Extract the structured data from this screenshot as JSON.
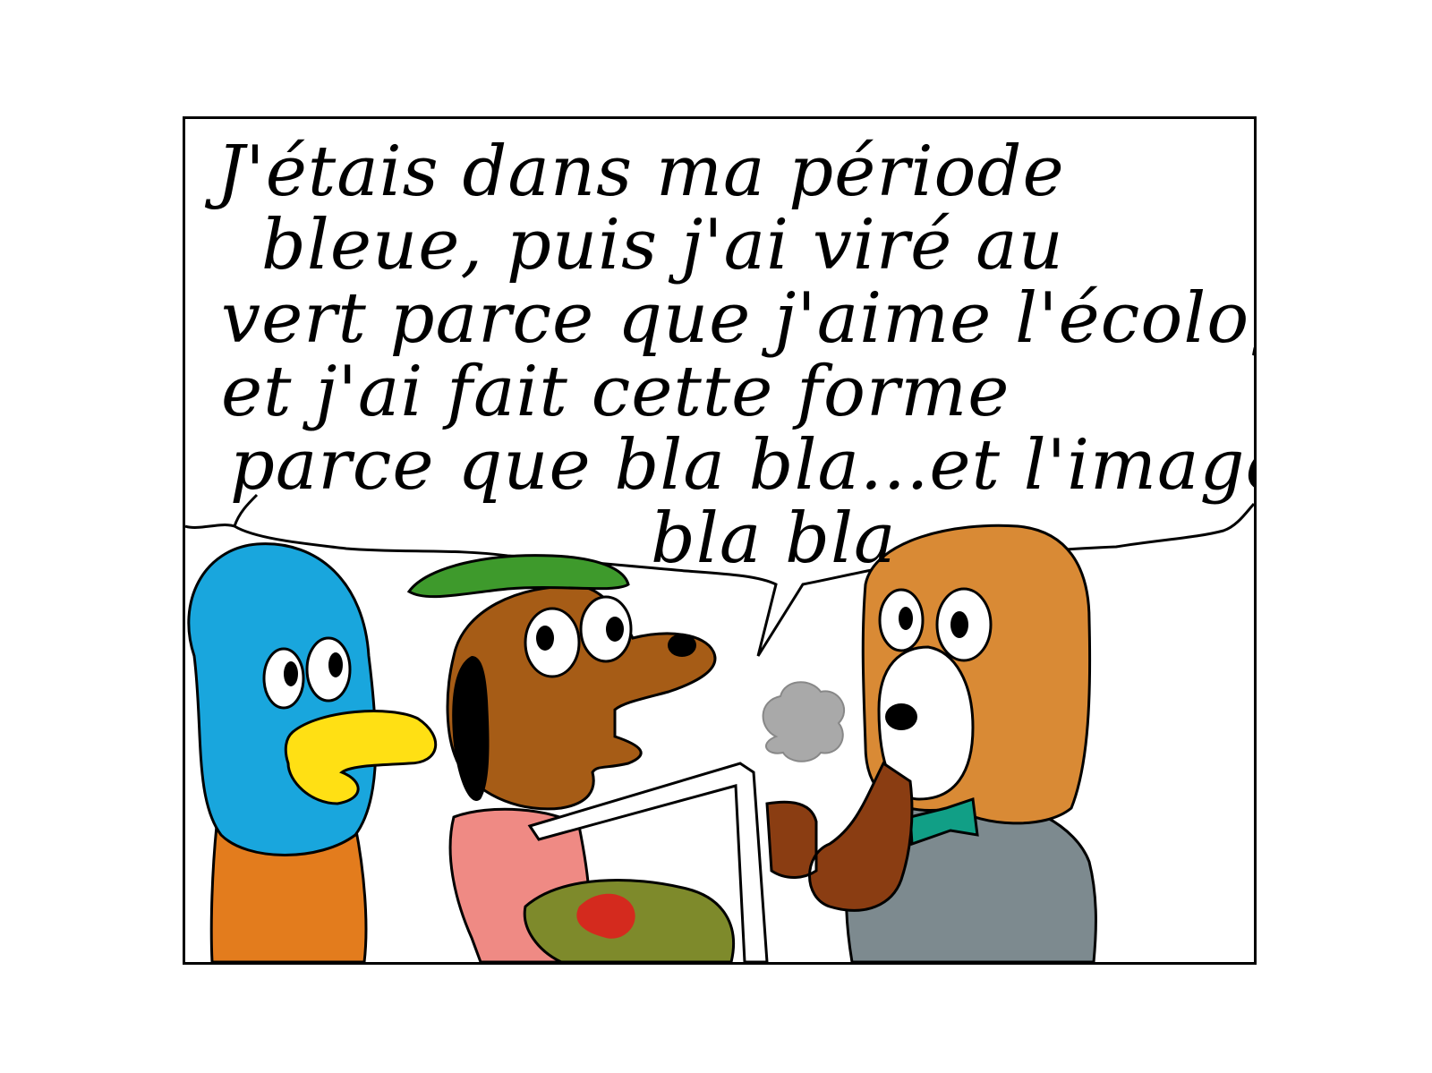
{
  "speech_bubble": {
    "lines": [
      "J'étais dans ma période",
      "bleue, puis j'ai viré au",
      "vert parce que j'aime l'écologie",
      "et j'ai fait cette forme",
      "parce que bla bla...et l'image",
      "bla bla"
    ]
  },
  "characters": {
    "duck": {
      "head_color": "#19a6dd",
      "beak_color": "#ffe014",
      "body_color": "#e37c1d"
    },
    "painter_dog": {
      "fur_color": "#a65c16",
      "beret_color": "#3e9a2c",
      "shirt_color": "#ef8a84"
    },
    "beagle": {
      "fur_color": "#d98a35",
      "bowtie_color": "#119f86",
      "suit_color": "#7d8a8f"
    }
  }
}
